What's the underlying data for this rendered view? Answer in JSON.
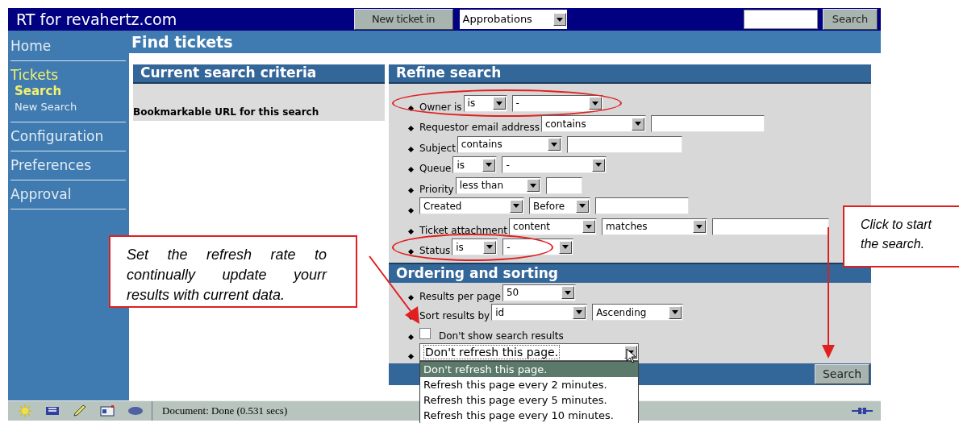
{
  "header": {
    "title": "RT for revahertz.com",
    "new_ticket_button": "New ticket in",
    "queue_select": "Approbations",
    "search_button": "Search"
  },
  "sidebar": {
    "items": [
      {
        "label": "Home",
        "selected": false
      },
      {
        "label": "Tickets",
        "selected": true,
        "children": [
          {
            "label": "Search",
            "selected": true
          },
          {
            "label": "New Search",
            "selected": false
          }
        ]
      },
      {
        "label": "Configuration",
        "selected": false
      },
      {
        "label": "Preferences",
        "selected": false
      },
      {
        "label": "Approval",
        "selected": false
      }
    ]
  },
  "page_title": "Find tickets",
  "criteria_panel": {
    "title": "Current search criteria",
    "bookmark_label": "Bookmarkable URL for this search"
  },
  "refine_panel": {
    "title": "Refine search",
    "rows": [
      {
        "label": "Owner is",
        "highlighted": true,
        "controls": [
          {
            "kind": "select",
            "value": "is"
          },
          {
            "kind": "select",
            "value": "-"
          }
        ]
      },
      {
        "label": "Requestor email address",
        "highlighted": false,
        "controls": [
          {
            "kind": "select",
            "value": "contains"
          },
          {
            "kind": "input"
          }
        ]
      },
      {
        "label": "Subject",
        "highlighted": false,
        "controls": [
          {
            "kind": "select",
            "value": "contains"
          },
          {
            "kind": "input"
          }
        ]
      },
      {
        "label": "Queue",
        "highlighted": false,
        "controls": [
          {
            "kind": "select",
            "value": "is"
          },
          {
            "kind": "select",
            "value": "-"
          }
        ]
      },
      {
        "label": "Priority",
        "highlighted": false,
        "controls": [
          {
            "kind": "select",
            "value": "less than"
          },
          {
            "kind": "input"
          }
        ]
      },
      {
        "highlighted": false,
        "controls": [
          {
            "kind": "select",
            "value": "Created"
          },
          {
            "kind": "select",
            "value": "Before"
          },
          {
            "kind": "input"
          }
        ]
      },
      {
        "label": "Ticket attachment",
        "highlighted": false,
        "controls": [
          {
            "kind": "select",
            "value": "content"
          },
          {
            "kind": "select",
            "value": "matches"
          },
          {
            "kind": "input"
          }
        ]
      },
      {
        "label": "Status",
        "highlighted": true,
        "controls": [
          {
            "kind": "select",
            "value": "is"
          },
          {
            "kind": "select",
            "value": "-"
          }
        ]
      }
    ]
  },
  "ordering_panel": {
    "title": "Ordering and sorting",
    "rows": [
      {
        "kind": "fields",
        "label": "Results per page",
        "controls": [
          {
            "kind": "select",
            "value": "50"
          }
        ]
      },
      {
        "kind": "fields",
        "label": "Sort results by",
        "controls": [
          {
            "kind": "select",
            "value": "id"
          },
          {
            "kind": "select",
            "value": "Ascending"
          }
        ]
      },
      {
        "kind": "checkbox",
        "label": "Don't show search results",
        "checked": false
      },
      {
        "kind": "dropdown",
        "value": "Don't refresh this page.",
        "expanded": true,
        "options": [
          {
            "label": "Don't refresh this page.",
            "selected": true
          },
          {
            "label": "Refresh this page every 2 minutes.",
            "selected": false
          },
          {
            "label": "Refresh this page every 5 minutes.",
            "selected": false
          },
          {
            "label": "Refresh this page every 10 minutes.",
            "selected": false
          }
        ]
      }
    ],
    "search_button": "Search"
  },
  "status_bar": {
    "text": "Document: Done (0.531 secs)"
  },
  "callouts": [
    {
      "text": "Set the refresh rate to continually update yourr results with current data."
    },
    {
      "text": "Click to start the search."
    }
  ]
}
